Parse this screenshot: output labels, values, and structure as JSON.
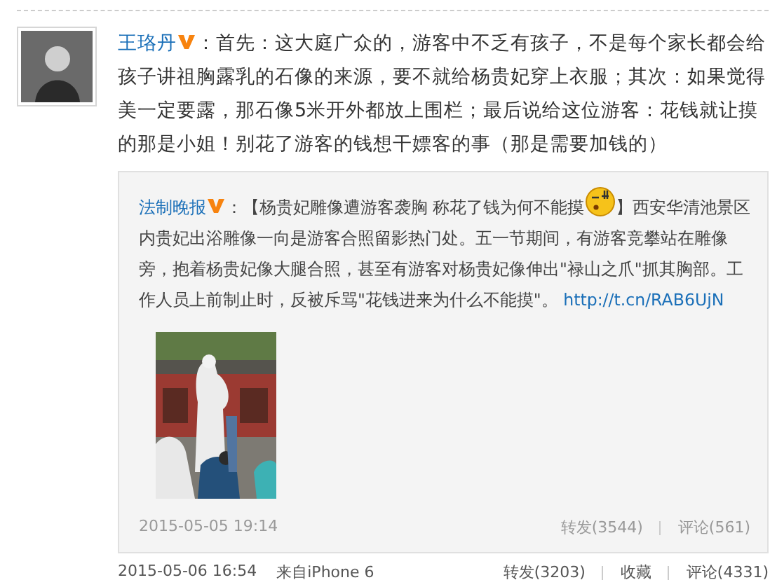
{
  "post": {
    "author": "王珞丹",
    "verified": true,
    "text": "：首先：这大庭广众的，游客中不乏有孩子，不是每个家长都会给孩子讲祖胸露乳的石像的来源，要不就给杨贵妃穿上衣服；其次：如果觉得美一定要露，那石像5米开外都放上围栏；最后说给这位游客：花钱就让摸的那是小姐！别花了游客的钱想干嫖客的事（那是需要加钱的）",
    "repost": {
      "author": "法制晚报",
      "verified": true,
      "text_before": "：【杨贵妃雕像遭游客袭胸 称花了钱为何不能摸",
      "text_after": "】西安华清池景区内贵妃出浴雕像一向是游客合照留影热门处。五一节期间，有游客竞攀站在雕像旁，抱着杨贵妃像大腿合照，甚至有游客对杨贵妃像伸出\"禄山之爪\"抓其胸部。工作人员上前制止时，反被斥骂\"花钱进来为什么不能摸\"。",
      "link": "http://t.cn/RAB6UjN",
      "image": {
        "kind": "picture"
      },
      "time": "2015-05-05 19:14",
      "actions": [
        "转发(3544)",
        "评论(561)"
      ]
    },
    "time": "2015-05-06 16:54",
    "source": "来自iPhone 6",
    "actions": [
      "转发(3203)",
      "收藏",
      "评论(4331)"
    ]
  }
}
